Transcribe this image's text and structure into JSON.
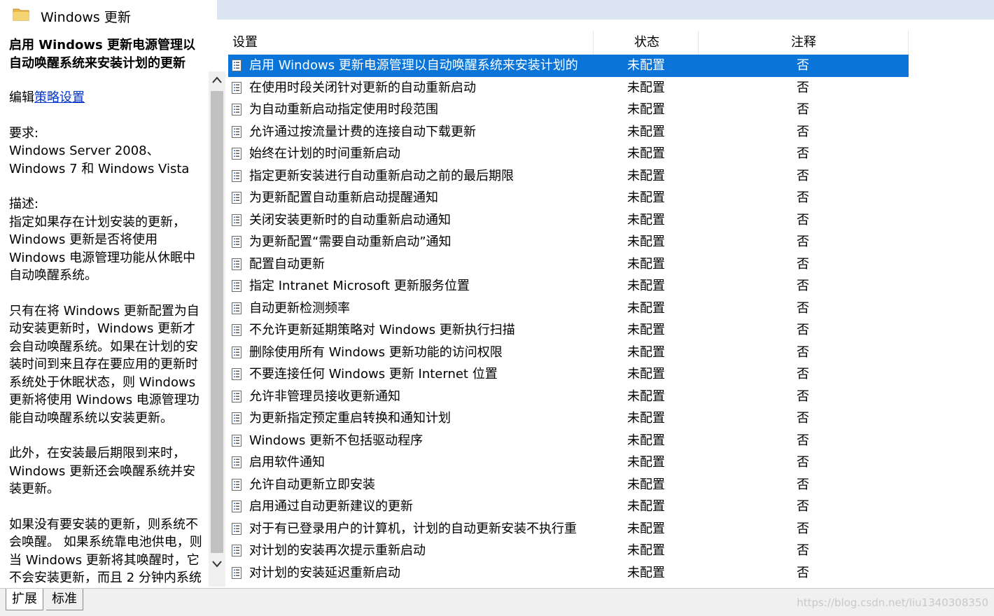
{
  "window": {
    "title": "Windows 更新"
  },
  "left_pane": {
    "title": "启用 Windows 更新电源管理以自动唤醒系统来安装计划的更新",
    "edit_prefix": "编辑",
    "edit_link": "策略设置",
    "requirements_label": "要求:",
    "requirements_text": "Windows Server 2008、Windows 7 和 Windows Vista",
    "description_label": "描述:",
    "description_p1": "指定如果存在计划安装的更新，Windows 更新是否将使用 Windows 电源管理功能从休眠中自动唤醒系统。",
    "description_p2": "只有在将 Windows 更新配置为自动安装更新时，Windows 更新才会自动唤醒系统。如果在计划的安装时间到来且存在要应用的更新时系统处于休眠状态，则 Windows 更新将使用 Windows 电源管理功能自动唤醒系统以安装更新。",
    "description_p3": "此外，在安装最后期限到来时，Windows 更新还会唤醒系统并安装更新。",
    "description_p4": "如果没有要安装的更新，则系统不会唤醒。 如果系统靠电池供电，则当 Windows 更新将其唤醒时，它不会安装更新，而且 2 分钟内系统"
  },
  "table": {
    "columns": {
      "setting": "设置",
      "state": "状态",
      "comment": "注释"
    },
    "rows": [
      {
        "name": "启用 Windows 更新电源管理以自动唤醒系统来安装计划的",
        "state": "未配置",
        "comment": "否",
        "selected": true
      },
      {
        "name": "在使用时段关闭针对更新的自动重新启动",
        "state": "未配置",
        "comment": "否"
      },
      {
        "name": "为自动重新启动指定使用时段范围",
        "state": "未配置",
        "comment": "否"
      },
      {
        "name": "允许通过按流量计费的连接自动下载更新",
        "state": "未配置",
        "comment": "否"
      },
      {
        "name": "始终在计划的时间重新启动",
        "state": "未配置",
        "comment": "否"
      },
      {
        "name": "指定更新安装进行自动重新启动之前的最后期限",
        "state": "未配置",
        "comment": "否"
      },
      {
        "name": "为更新配置自动重新启动提醒通知",
        "state": "未配置",
        "comment": "否"
      },
      {
        "name": "关闭安装更新时的自动重新启动通知",
        "state": "未配置",
        "comment": "否"
      },
      {
        "name": "为更新配置“需要自动重新启动”通知",
        "state": "未配置",
        "comment": "否"
      },
      {
        "name": "配置自动更新",
        "state": "未配置",
        "comment": "否"
      },
      {
        "name": "指定 Intranet Microsoft 更新服务位置",
        "state": "未配置",
        "comment": "否"
      },
      {
        "name": "自动更新检测频率",
        "state": "未配置",
        "comment": "否"
      },
      {
        "name": "不允许更新延期策略对 Windows 更新执行扫描",
        "state": "未配置",
        "comment": "否"
      },
      {
        "name": "删除使用所有 Windows 更新功能的访问权限",
        "state": "未配置",
        "comment": "否"
      },
      {
        "name": "不要连接任何 Windows 更新 Internet 位置",
        "state": "未配置",
        "comment": "否"
      },
      {
        "name": "允许非管理员接收更新通知",
        "state": "未配置",
        "comment": "否"
      },
      {
        "name": "为更新指定预定重启转换和通知计划",
        "state": "未配置",
        "comment": "否"
      },
      {
        "name": "Windows 更新不包括驱动程序",
        "state": "未配置",
        "comment": "否"
      },
      {
        "name": "启用软件通知",
        "state": "未配置",
        "comment": "否"
      },
      {
        "name": "允许自动更新立即安装",
        "state": "未配置",
        "comment": "否"
      },
      {
        "name": "启用通过自动更新建议的更新",
        "state": "未配置",
        "comment": "否"
      },
      {
        "name": "对于有已登录用户的计算机，计划的自动更新安装不执行重",
        "state": "未配置",
        "comment": "否"
      },
      {
        "name": "对计划的安装再次提示重新启动",
        "state": "未配置",
        "comment": "否"
      },
      {
        "name": "对计划的安装延迟重新启动",
        "state": "未配置",
        "comment": "否"
      }
    ]
  },
  "bottom_tabs": {
    "extended": "扩展",
    "standard": "标准"
  },
  "watermark": "https://blog.csdn.net/liu1340308350",
  "colors": {
    "selection": "#0a74d8",
    "title_bar": "#dbe4f1",
    "link": "#0033cc"
  },
  "icons": {
    "folder": "folder-icon",
    "policy": "policy-setting-icon",
    "scroll_up": "chevron-up-icon",
    "scroll_down": "chevron-down-icon"
  }
}
